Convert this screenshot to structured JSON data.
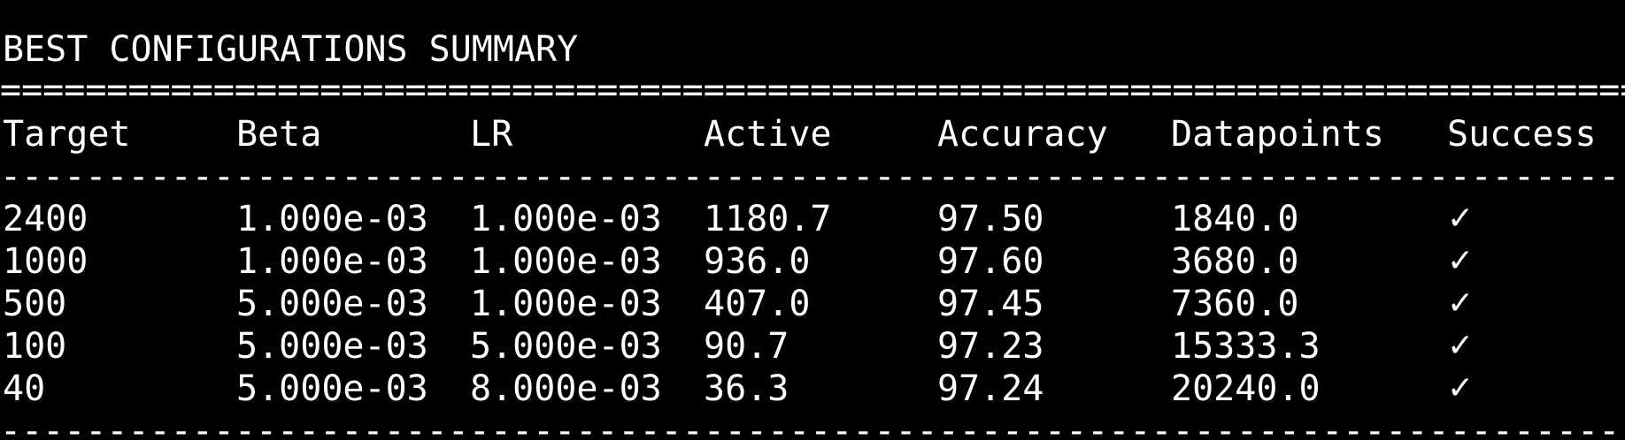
{
  "title": "BEST CONFIGURATIONS SUMMARY",
  "double_rule": "================================================================================",
  "single_rule": "--------------------------------------------------------------------------------",
  "columns": [
    "Target",
    "Beta",
    "LR",
    "Active",
    "Accuracy",
    "Datapoints",
    "Success"
  ],
  "rows": [
    {
      "target": "2400",
      "beta": "1.000e-03",
      "lr": "1.000e-03",
      "active": "1180.7",
      "accuracy": "97.50",
      "datapoints": "1840.0",
      "success": "✓"
    },
    {
      "target": "1000",
      "beta": "1.000e-03",
      "lr": "1.000e-03",
      "active": "936.0",
      "accuracy": "97.60",
      "datapoints": "3680.0",
      "success": "✓"
    },
    {
      "target": "500",
      "beta": "5.000e-03",
      "lr": "1.000e-03",
      "active": "407.0",
      "accuracy": "97.45",
      "datapoints": "7360.0",
      "success": "✓"
    },
    {
      "target": "100",
      "beta": "5.000e-03",
      "lr": "5.000e-03",
      "active": "90.7",
      "accuracy": "97.23",
      "datapoints": "15333.3",
      "success": "✓"
    },
    {
      "target": "40",
      "beta": "5.000e-03",
      "lr": "8.000e-03",
      "active": "36.3",
      "accuracy": "97.24",
      "datapoints": "20240.0",
      "success": "✓"
    }
  ]
}
